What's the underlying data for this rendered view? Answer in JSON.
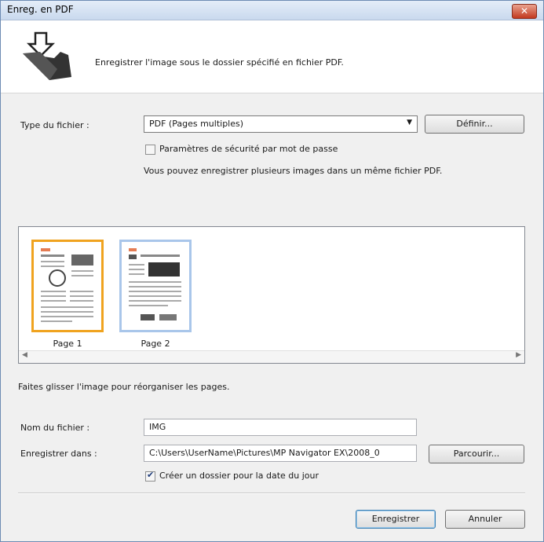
{
  "window": {
    "title": "Enreg. en PDF",
    "close_glyph": "✕"
  },
  "header": {
    "description": "Enregistrer l'image sous le dossier spécifié en fichier PDF."
  },
  "file_type": {
    "label": "Type du fichier :",
    "selected": "PDF (Pages multiples)",
    "define_button": "Définir...",
    "password_checkbox_label": "Paramètres de sécurité par mot de passe",
    "password_checked": false,
    "info": "Vous pouvez enregistrer plusieurs images dans un même fichier PDF."
  },
  "pages": [
    {
      "label": "Page 1",
      "selected": true
    },
    {
      "label": "Page 2",
      "selected": false
    }
  ],
  "drag_hint": "Faites glisser l'image pour réorganiser les pages.",
  "filename": {
    "label": "Nom du fichier :",
    "value": "IMG"
  },
  "save_in": {
    "label": "Enregistrer dans :",
    "value": "C:\\Users\\UserName\\Pictures\\MP Navigator EX\\2008_0",
    "browse_button": "Parcourir...",
    "date_folder_label": "Créer un dossier pour la date du jour",
    "date_folder_checked": true
  },
  "footer": {
    "save_button": "Enregistrer",
    "cancel_button": "Annuler"
  },
  "colors": {
    "selected_border": "#f0a31f",
    "unselected_border": "#a9c6ea",
    "close_button": "#c2391f"
  }
}
